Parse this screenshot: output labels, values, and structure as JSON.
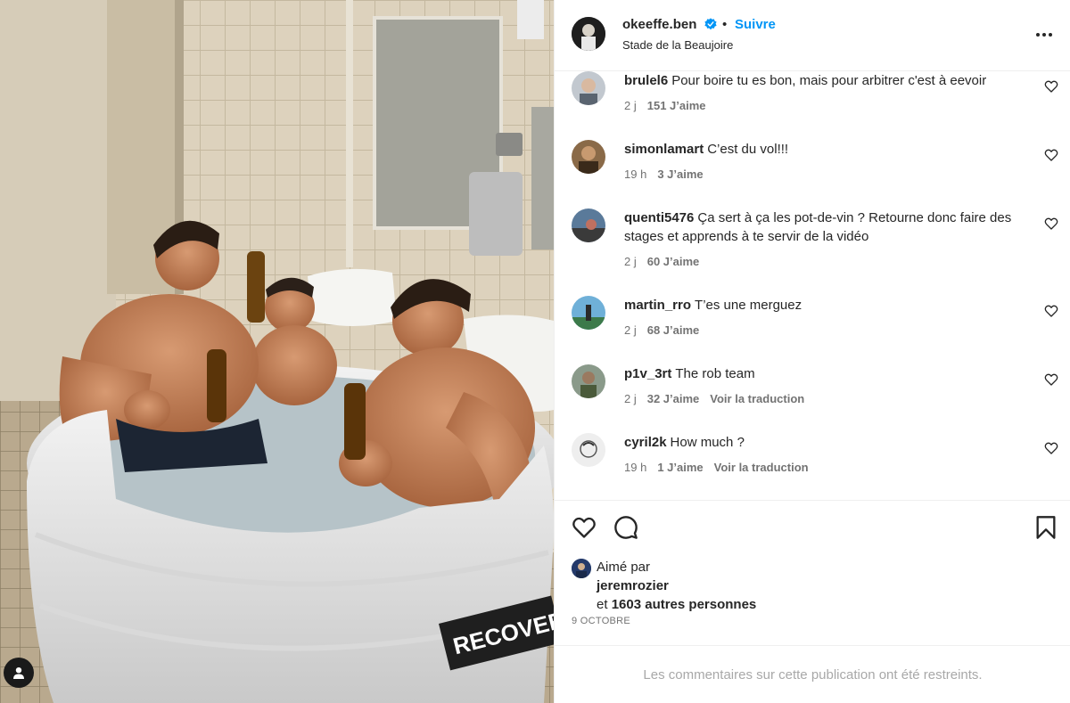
{
  "post": {
    "author": "okeeffe.ben",
    "verified": true,
    "separator": "•",
    "follow_label": "Suivre",
    "location": "Stade de la Beaujoire",
    "photo_text": "RECOVERY"
  },
  "comments": [
    {
      "user": "brulel6",
      "text": "Pour boire tu es bon, mais pour arbitrer c'est à eevoir",
      "time": "2 j",
      "likes": "151 J’aime",
      "translate": "",
      "avatar_color": "#9aa7b3"
    },
    {
      "user": "simonlamart",
      "text": "C’est du vol!!!",
      "time": "19 h",
      "likes": "3 J’aime",
      "translate": "",
      "avatar_color": "#7a5a3a"
    },
    {
      "user": "quenti5476",
      "text": "Ça sert à ça les pot-de-vin ? Retourne donc faire des stages et apprends à te servir de la vidéo",
      "time": "2 j",
      "likes": "60 J’aime",
      "translate": "",
      "avatar_color": "#4a6a8a"
    },
    {
      "user": "martin_rro",
      "text": "T’es une merguez",
      "time": "2 j",
      "likes": "68 J’aime",
      "translate": "",
      "avatar_color": "#3a8ab0"
    },
    {
      "user": "p1v_3rt",
      "text": "The rob team",
      "time": "2 j",
      "likes": "32 J’aime",
      "translate": "Voir la traduction",
      "avatar_color": "#6a7a5a"
    },
    {
      "user": "cyril2k",
      "text": "How much ?",
      "time": "19 h",
      "likes": "1 J’aime",
      "translate": "Voir la traduction",
      "avatar_color": "#e8e8e8"
    }
  ],
  "likes": {
    "liked_by_label": "Aimé par",
    "liked_by_user": "jeremrozier",
    "others_prefix": "et",
    "others_label": "1603 autres personnes"
  },
  "date": "9 OCTOBRE",
  "restricted_notice": "Les commentaires sur cette publication ont été restreints.",
  "colors": {
    "accent": "#0095f6",
    "text": "#262626",
    "muted": "#737373"
  },
  "icons": [
    "user-tag-icon",
    "verified-icon",
    "more-options-icon",
    "heart-icon",
    "comment-icon",
    "bookmark-icon"
  ]
}
